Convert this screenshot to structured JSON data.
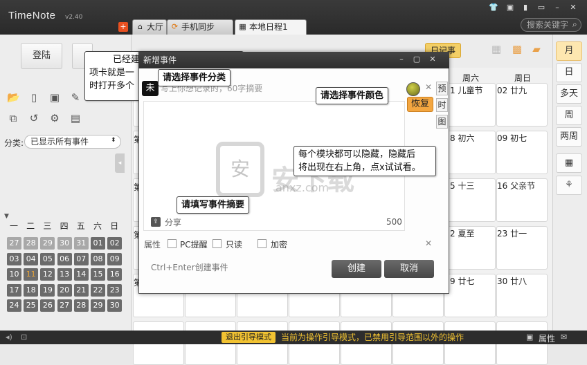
{
  "app": {
    "name": "TimeNote",
    "version": "v2.40"
  },
  "search": {
    "placeholder": "搜索关键字"
  },
  "tabs": [
    {
      "label": "大厅"
    },
    {
      "label": "手机同步"
    },
    {
      "label": "本地日程1"
    }
  ],
  "left": {
    "login": "登陆",
    "category_label": "分类:",
    "category_value": "已显示所有事件",
    "weekdays": [
      "一",
      "二",
      "三",
      "四",
      "五",
      "六",
      "日"
    ],
    "days": [
      [
        "27",
        "28",
        "29",
        "30",
        "31",
        "01",
        "02"
      ],
      [
        "03",
        "04",
        "05",
        "06",
        "07",
        "08",
        "09"
      ],
      [
        "10",
        "11",
        "12",
        "13",
        "14",
        "15",
        "16"
      ],
      [
        "17",
        "18",
        "19",
        "20",
        "21",
        "22",
        "23"
      ],
      [
        "24",
        "25",
        "26",
        "27",
        "28",
        "29",
        "30"
      ]
    ]
  },
  "calendar": {
    "headers": [
      "周六",
      "周日"
    ],
    "cells": [
      [
        "1 儿童节",
        "02 廿九"
      ],
      [
        "8 初六",
        "09 初七"
      ],
      [
        "5 十三",
        "16 父亲节"
      ],
      [
        "2 夏至",
        "23 廿一"
      ],
      [
        "9 廿七",
        "30 廿八"
      ]
    ],
    "row_marks": [
      "第",
      "第",
      "第",
      "第"
    ]
  },
  "right": {
    "views": [
      "月",
      "日",
      "多天",
      "周",
      "两周"
    ]
  },
  "status": {
    "exit_guide": "退出引导模式",
    "message": "当前为操作引导模式，已禁用引导范围以外的操作",
    "properties": "属性"
  },
  "dialog": {
    "title": "新增事件",
    "category_chip": "未",
    "title_placeholder": "写上你想记录的，60字摘要",
    "summary_count": "500",
    "share": "分享",
    "props_label": "属性",
    "pc_remind": "PC提醒",
    "readonly": "只读",
    "encrypt": "加密",
    "hint": "Ctrl+Enter创建事件",
    "create": "创建",
    "cancel": "取消",
    "side_tabs": [
      "预",
      "时",
      "图"
    ]
  },
  "callouts": {
    "select_category": "请选择事件分类",
    "select_color": "请选择事件颜色",
    "fill_summary": "请填写事件摘要",
    "modules_hint_1": "每个模块都可以隐藏，隐藏后",
    "modules_hint_2": "将出现在右上角，点x试试看。",
    "top_hint_1": "已经建",
    "top_hint_2": "项卡就是一",
    "top_hint_3": "时打开多个",
    "restore": "恢复",
    "rijishi": "日记事"
  },
  "watermark": {
    "text": "安下载",
    "url": "anxz.com",
    "glyph": "安"
  }
}
